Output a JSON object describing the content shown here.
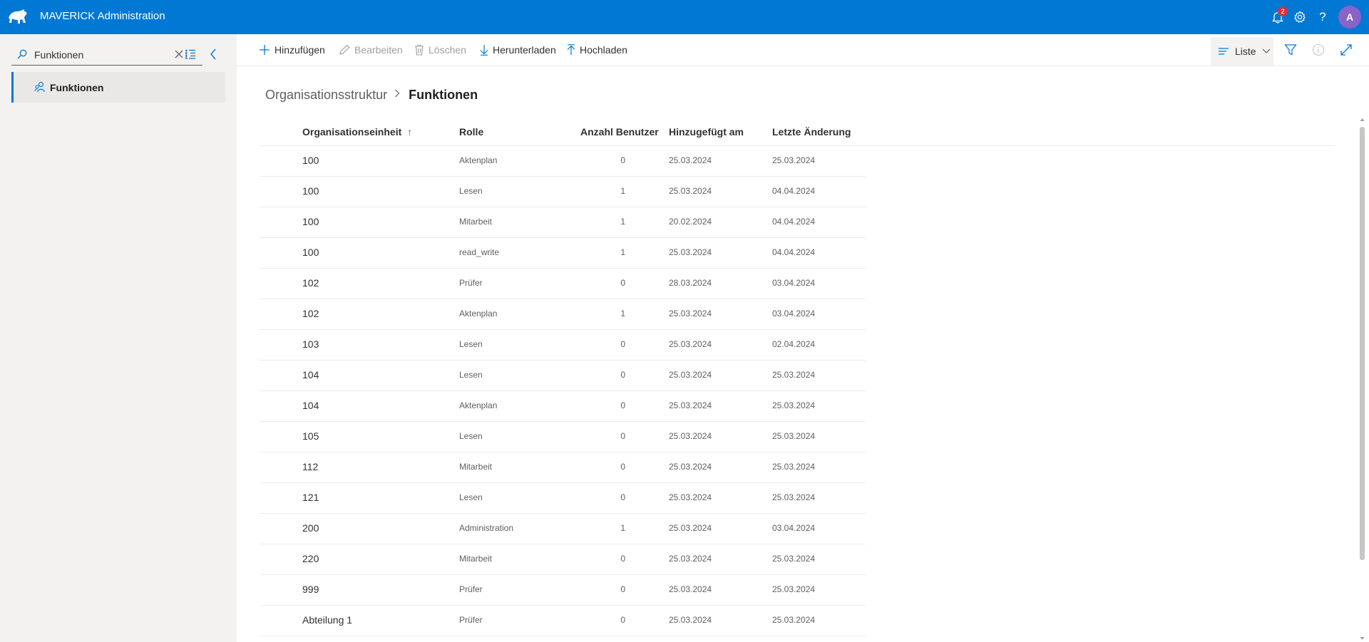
{
  "header": {
    "app_title": "MAVERICK Administration",
    "notification_count": "2",
    "avatar_initial": "A",
    "accent_color": "#0078d4"
  },
  "sidebar": {
    "search_value": "Funktionen",
    "items": [
      {
        "label": "Funktionen",
        "icon": "people-icon"
      }
    ]
  },
  "toolbar": {
    "add_label": "Hinzufügen",
    "edit_label": "Bearbeiten",
    "delete_label": "Löschen",
    "download_label": "Herunterladen",
    "upload_label": "Hochladen",
    "view_label": "Liste"
  },
  "breadcrumb": {
    "parent": "Organisationsstruktur",
    "current": "Funktionen"
  },
  "table": {
    "columns": [
      "Organisationseinheit",
      "Rolle",
      "Anzahl Benutzer",
      "Hinzugefügt am",
      "Letzte Änderung"
    ],
    "sort_indicator": "↑",
    "rows": [
      [
        "100",
        "Aktenplan",
        "0",
        "25.03.2024",
        "25.03.2024"
      ],
      [
        "100",
        "Lesen",
        "1",
        "25.03.2024",
        "04.04.2024"
      ],
      [
        "100",
        "Mitarbeit",
        "1",
        "20.02.2024",
        "04.04.2024"
      ],
      [
        "100",
        "read_write",
        "1",
        "25.03.2024",
        "04.04.2024"
      ],
      [
        "102",
        "Prüfer",
        "0",
        "28.03.2024",
        "03.04.2024"
      ],
      [
        "102",
        "Aktenplan",
        "1",
        "25.03.2024",
        "03.04.2024"
      ],
      [
        "103",
        "Lesen",
        "0",
        "25.03.2024",
        "02.04.2024"
      ],
      [
        "104",
        "Lesen",
        "0",
        "25.03.2024",
        "25.03.2024"
      ],
      [
        "104",
        "Aktenplan",
        "0",
        "25.03.2024",
        "25.03.2024"
      ],
      [
        "105",
        "Lesen",
        "0",
        "25.03.2024",
        "25.03.2024"
      ],
      [
        "112",
        "Mitarbeit",
        "0",
        "25.03.2024",
        "25.03.2024"
      ],
      [
        "121",
        "Lesen",
        "0",
        "25.03.2024",
        "25.03.2024"
      ],
      [
        "200",
        "Administration",
        "1",
        "25.03.2024",
        "03.04.2024"
      ],
      [
        "220",
        "Mitarbeit",
        "0",
        "25.03.2024",
        "25.03.2024"
      ],
      [
        "999",
        "Prüfer",
        "0",
        "25.03.2024",
        "25.03.2024"
      ],
      [
        "Abteilung 1",
        "Prüfer",
        "0",
        "25.03.2024",
        "25.03.2024"
      ]
    ]
  }
}
